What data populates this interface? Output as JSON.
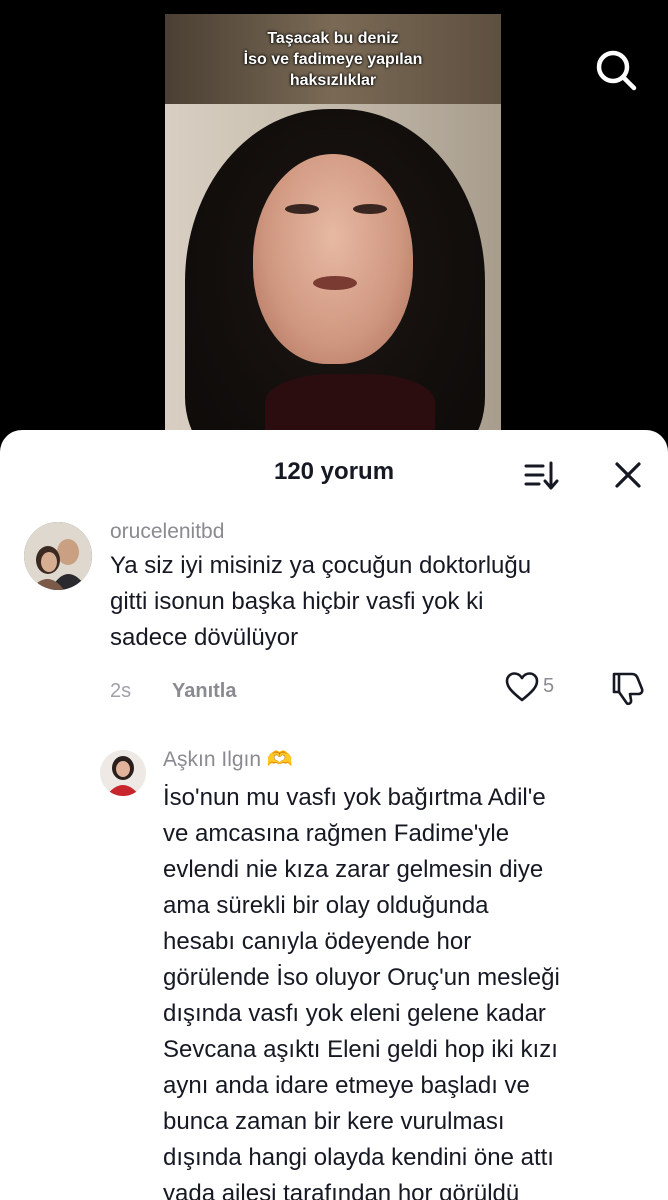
{
  "video": {
    "caption_lines": [
      "Taşacak bu deniz",
      "İso ve fadimeye yapılan",
      "haksızlıklar"
    ]
  },
  "comments_sheet": {
    "title": "120 yorum"
  },
  "comments": [
    {
      "username": "orucelenitbd",
      "lines": [
        "Ya siz iyi misiniz ya çocuğun doktorluğu",
        "gitti isonun başka hiçbir vasfi yok ki",
        "sadece dövülüyor"
      ],
      "time": "2s",
      "reply_label": "Yanıtla",
      "likes": "5"
    },
    {
      "username": "Aşkın Ilgın 🫶",
      "lines": [
        "İso'nun mu vasfı yok bağırtma Adil'e",
        "ve amcasına rağmen Fadime'yle",
        "evlendi nie kıza zarar gelmesin diye",
        "ama sürekli bir olay olduğunda",
        "hesabı canıyla ödeyende hor",
        "görülende İso oluyor Oruç'un mesleği",
        "dışında vasfı yok eleni gelene kadar",
        "Sevcana aşıktı Eleni geldi hop iki kızı",
        "aynı anda idare etmeye başladı ve",
        "bunca zaman bir kere vurulması",
        "dışında hangi olayda kendini öne attı",
        "yada ailesi tarafından hor görüldü"
      ]
    }
  ],
  "icons": {
    "search": "search-icon",
    "sort": "sort-icon",
    "close": "close-icon",
    "like": "heart-icon",
    "dislike": "thumbs-down-icon"
  },
  "colors": {
    "text_primary": "#161823",
    "text_secondary": "#8a8b91"
  }
}
